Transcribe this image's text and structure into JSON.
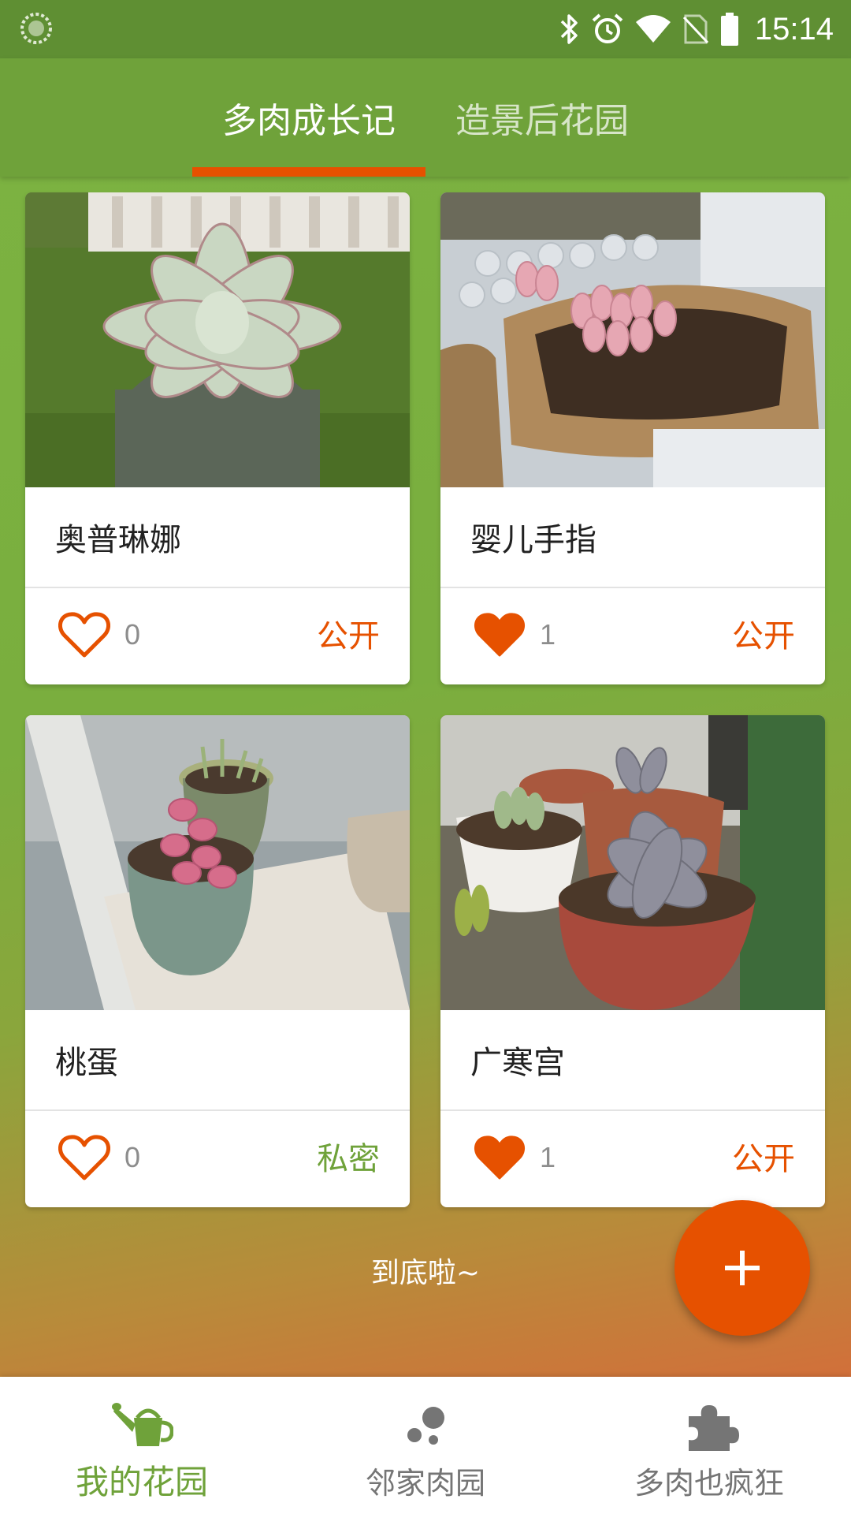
{
  "status_bar": {
    "time": "15:14",
    "icons": [
      "loading-icon",
      "bluetooth-icon",
      "alarm-icon",
      "wifi-icon",
      "no-sim-icon",
      "battery-icon"
    ]
  },
  "tabs": [
    {
      "label": "多肉成长记",
      "selected": true
    },
    {
      "label": "造景后花园",
      "selected": false
    }
  ],
  "cards": [
    {
      "title": "奥普琳娜",
      "likes": "0",
      "liked": false,
      "visibility": "公开",
      "image": "succulent-photo"
    },
    {
      "title": "婴儿手指",
      "likes": "1",
      "liked": true,
      "visibility": "公开",
      "image": "succulent-photo"
    },
    {
      "title": "桃蛋",
      "likes": "0",
      "liked": false,
      "visibility": "私密",
      "image": "succulent-photo"
    },
    {
      "title": "广寒宫",
      "likes": "1",
      "liked": true,
      "visibility": "公开",
      "image": "succulent-photo"
    }
  ],
  "end_text": "到底啦~",
  "fab": {
    "icon": "plus-icon"
  },
  "bottom_nav": [
    {
      "label": "我的花园",
      "icon": "watering-can-icon",
      "selected": true
    },
    {
      "label": "邻家肉园",
      "icon": "bubbles-icon",
      "selected": false
    },
    {
      "label": "多肉也疯狂",
      "icon": "puzzle-icon",
      "selected": false
    }
  ],
  "colors": {
    "primary_green": "#6fa23a",
    "accent_orange": "#e65100",
    "status_bar": "#5f8f33"
  }
}
